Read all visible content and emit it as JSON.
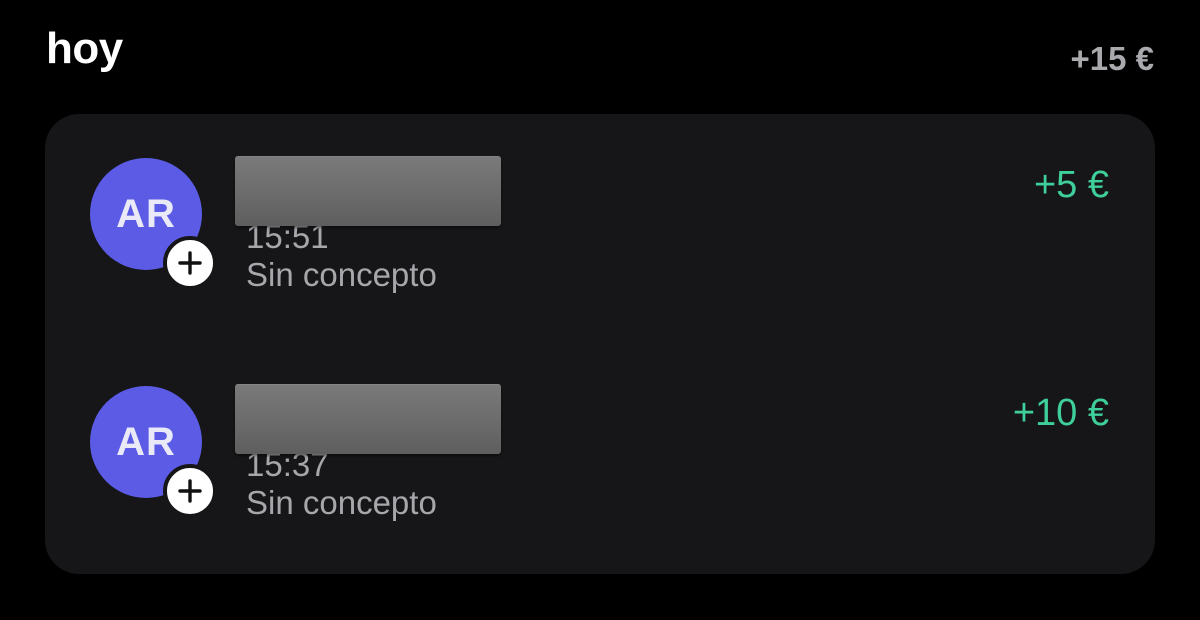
{
  "section": {
    "title": "hoy",
    "total": "+15 €"
  },
  "transactions": [
    {
      "avatar_initials": "AR",
      "add_icon": "plus-icon",
      "time": "15:51",
      "concept": "Sin concepto",
      "amount": "+5 €"
    },
    {
      "avatar_initials": "AR",
      "add_icon": "plus-icon",
      "time": "15:37",
      "concept": "Sin concepto",
      "amount": "+10 €"
    }
  ],
  "colors": {
    "background": "#000000",
    "card": "#161618",
    "avatar": "#5b5be6",
    "amount_positive": "#3ecf9a",
    "secondary_text": "#a6a6ab"
  }
}
